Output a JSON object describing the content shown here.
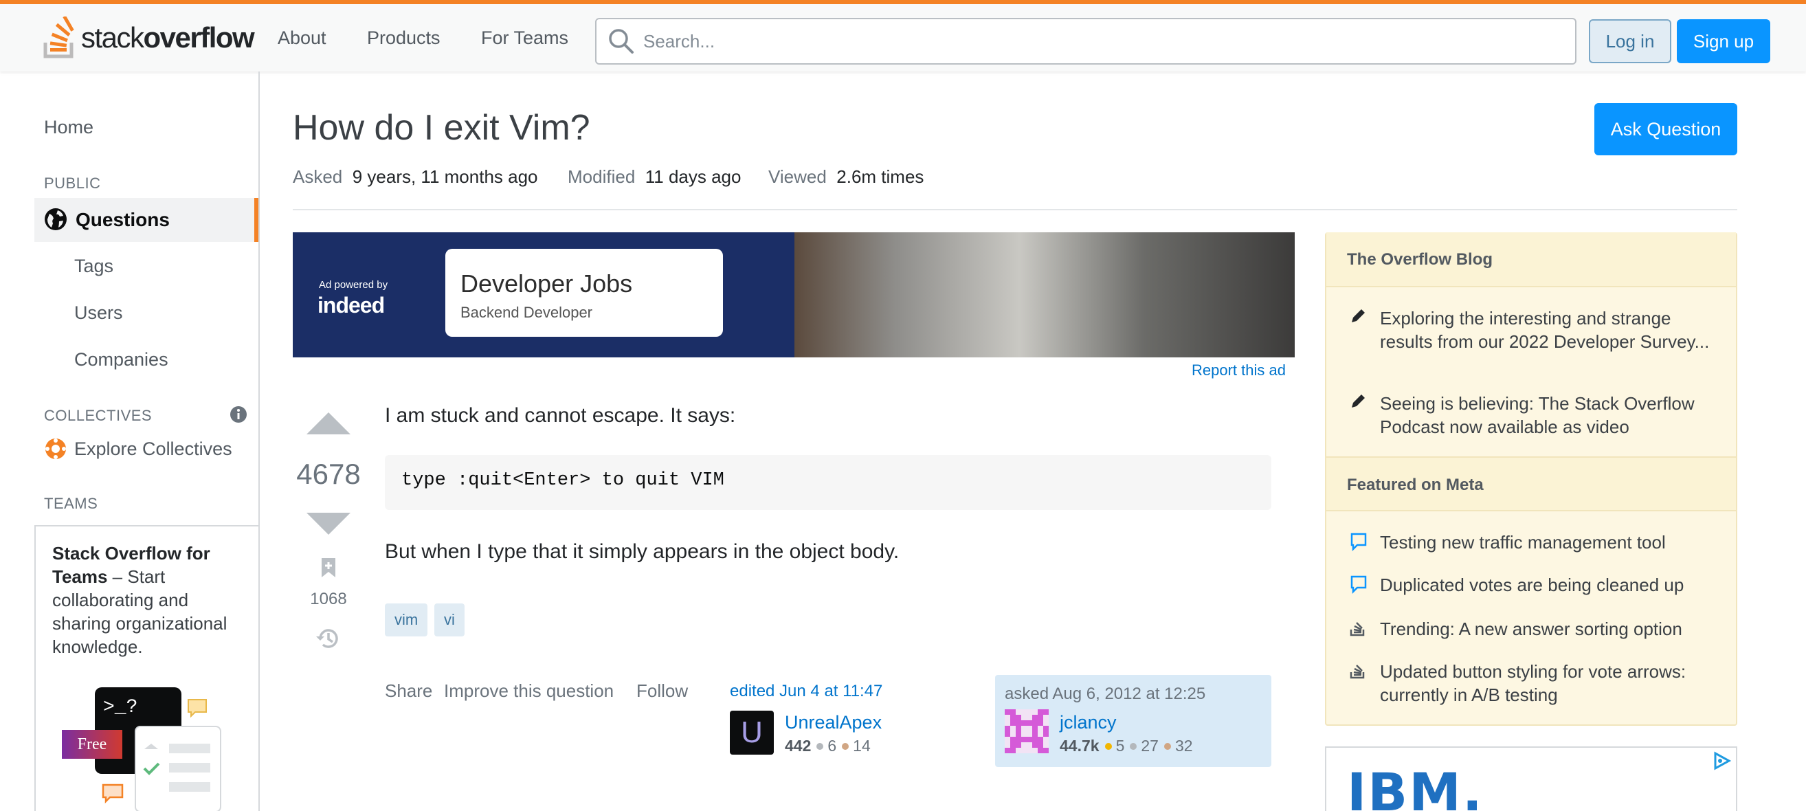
{
  "header": {
    "logo_text_regular": "stack",
    "logo_text_bold": "overflow",
    "nav": [
      "About",
      "Products",
      "For Teams"
    ],
    "search_placeholder": "Search...",
    "login_label": "Log in",
    "signup_label": "Sign up"
  },
  "sidebar": {
    "home": "Home",
    "public_header": "PUBLIC",
    "questions": "Questions",
    "tags": "Tags",
    "users": "Users",
    "companies": "Companies",
    "collectives_header": "COLLECTIVES",
    "explore_collectives": "Explore Collectives",
    "teams_header": "TEAMS",
    "teams_promo_bold": "Stack Overflow for Teams",
    "teams_promo_text": " – Start collaborating and sharing organizational knowledge.",
    "free_badge": "Free",
    "terminal_prompt": ">_?"
  },
  "question": {
    "title": "How do I exit Vim?",
    "ask_button": "Ask Question",
    "asked_label": "Asked",
    "asked_value": "9 years, 11 months ago",
    "modified_label": "Modified",
    "modified_value": "11 days ago",
    "viewed_label": "Viewed",
    "viewed_value": "2.6m times",
    "score": "4678",
    "bookmarks": "1068",
    "body_line1": "I am stuck and cannot escape. It says:",
    "code": "type :quit<Enter> to quit VIM",
    "body_line2": "But when I type that it simply appears in the object body.",
    "tags": [
      "vim",
      "vi"
    ],
    "actions": [
      "Share",
      "Improve this question",
      "Follow"
    ]
  },
  "ad": {
    "powered_by": "Ad powered by",
    "brand": "indeed",
    "card_title": "Developer Jobs",
    "card_subtitle": "Backend Developer",
    "report": "Report this ad"
  },
  "editor": {
    "when": "edited Jun 4 at 11:47",
    "avatar_letter": "U",
    "name": "UnrealApex",
    "rep": "442",
    "silver": "6",
    "bronze": "14"
  },
  "asker": {
    "when": "asked Aug 6, 2012 at 12:25",
    "name": "jclancy",
    "rep": "44.7k",
    "gold": "5",
    "silver": "27",
    "bronze": "32"
  },
  "right_sidebar": {
    "blog_header": "The Overflow Blog",
    "blog_items": [
      "Exploring the interesting and strange results from our 2022 Developer Survey...",
      "Seeing is believing: The Stack Overflow Podcast now available as video"
    ],
    "meta_header": "Featured on Meta",
    "meta_items": [
      "Testing new traffic management tool",
      "Duplicated votes are being cleaned up",
      "Trending: A new answer sorting option",
      "Updated button styling for vote arrows: currently in A/B testing"
    ]
  },
  "ibm_ad": {
    "logo": "IBM."
  },
  "colors": {
    "accent_orange": "#f48225",
    "primary_blue": "#0a95ff",
    "link_blue": "#0074cc",
    "sidebar_yellow": "#fdf7e2",
    "tag_bg": "#e1ecf4"
  }
}
